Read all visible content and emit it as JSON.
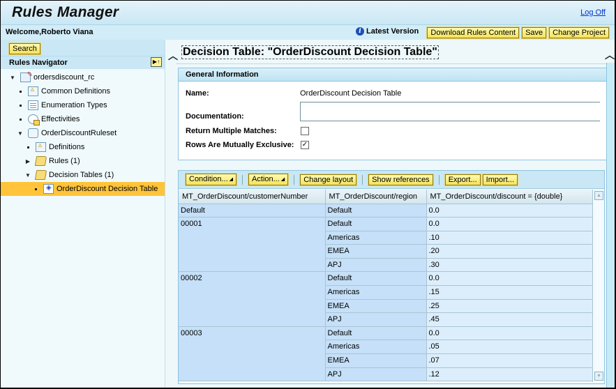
{
  "app": {
    "title": "Rules Manager",
    "logoff": "Log Off",
    "welcome": "Welcome,Roberto Viana",
    "version_label": "Latest Version",
    "buttons": {
      "download": "Download Rules Content",
      "save": "Save",
      "change_project": "Change Project"
    }
  },
  "sidebar": {
    "search_label": "Search",
    "navigator_title": "Rules Navigator",
    "tree": [
      {
        "label": "ordersdiscount_rc",
        "icon": "project-icon",
        "toggle": "expanded",
        "level": 0
      },
      {
        "label": "Common Definitions",
        "icon": "definitions-icon",
        "toggle": "leaf",
        "level": 1
      },
      {
        "label": "Enumeration Types",
        "icon": "enumeration-icon",
        "toggle": "leaf",
        "level": 1
      },
      {
        "label": "Effectivities",
        "icon": "effectivity-icon",
        "toggle": "leaf",
        "level": 1
      },
      {
        "label": "OrderDiscountRuleset",
        "icon": "ruleset-icon",
        "toggle": "expanded",
        "level": 1
      },
      {
        "label": "Definitions",
        "icon": "definitions-icon",
        "toggle": "leaf",
        "level": 2
      },
      {
        "label": "Rules (1)",
        "icon": "rules-folder-icon",
        "toggle": "collapsed",
        "level": 2
      },
      {
        "label": "Decision Tables (1)",
        "icon": "decision-tables-folder-icon",
        "toggle": "expanded",
        "level": 2
      },
      {
        "label": "OrderDiscount Decision Table",
        "icon": "decision-table-icon",
        "toggle": "leaf",
        "level": 3,
        "selected": true
      }
    ]
  },
  "main": {
    "title": "Decision Table: \"OrderDiscount Decision Table\"",
    "general": {
      "heading": "General Information",
      "name_label": "Name:",
      "name_value": "OrderDiscount Decision Table",
      "documentation_label": "Documentation:",
      "documentation_value": "",
      "return_multiple_label": "Return Multiple Matches:",
      "return_multiple_checked": false,
      "mutually_exclusive_label": "Rows Are Mutually Exclusive:",
      "mutually_exclusive_checked": true,
      "check_mark": "✓"
    },
    "toolbar": {
      "condition": "Condition...",
      "action": "Action...",
      "change_layout": "Change layout",
      "show_references": "Show references",
      "export": "Export...",
      "import": "Import..."
    },
    "table": {
      "columns": [
        "MT_OrderDiscount/customerNumber",
        "MT_OrderDiscount/region",
        "MT_OrderDiscount/discount = {double}"
      ],
      "groups": [
        {
          "customer": "Default",
          "rows": [
            {
              "region": "Default",
              "discount": "0.0"
            }
          ]
        },
        {
          "customer": "00001",
          "rows": [
            {
              "region": "Default",
              "discount": "0.0"
            },
            {
              "region": "Americas",
              "discount": ".10"
            },
            {
              "region": "EMEA",
              "discount": ".20"
            },
            {
              "region": "APJ",
              "discount": ".30"
            }
          ]
        },
        {
          "customer": "00002",
          "rows": [
            {
              "region": "Default",
              "discount": "0.0"
            },
            {
              "region": "Americas",
              "discount": ".15"
            },
            {
              "region": "EMEA",
              "discount": ".25"
            },
            {
              "region": "APJ",
              "discount": ".45"
            }
          ]
        },
        {
          "customer": "00003",
          "rows": [
            {
              "region": "Default",
              "discount": "0.0"
            },
            {
              "region": "Americas",
              "discount": ".05"
            },
            {
              "region": "EMEA",
              "discount": ".07"
            },
            {
              "region": "APJ",
              "discount": ".12"
            }
          ]
        }
      ]
    }
  },
  "colors": {
    "accent_yellow": "#f6e25a",
    "selected_item": "#ffc43a",
    "header_blue": "#c9e7f4",
    "cell_blue": "#c5e0f8",
    "link": "#0033cc"
  }
}
